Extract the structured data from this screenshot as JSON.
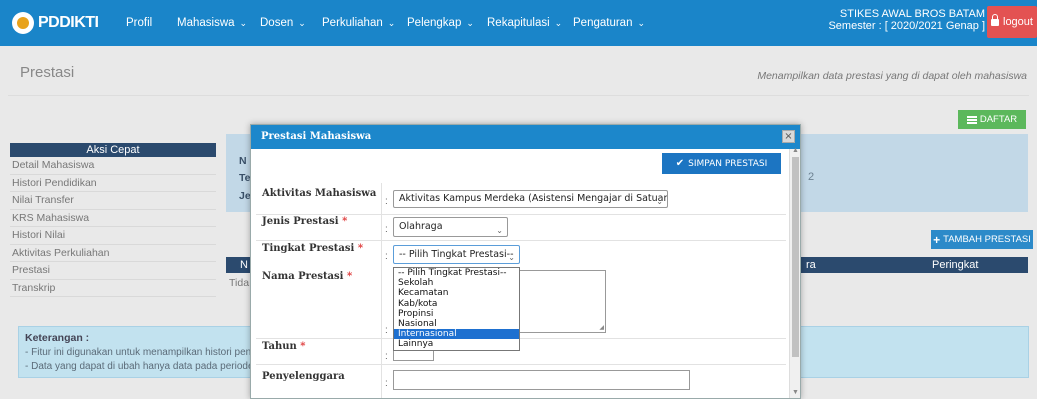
{
  "brand": {
    "name": "PDDIKTI"
  },
  "nav": [
    {
      "label": "Profil",
      "dropdown": false
    },
    {
      "label": "Mahasiswa",
      "dropdown": true
    },
    {
      "label": "Dosen",
      "dropdown": true
    },
    {
      "label": "Perkuliahan",
      "dropdown": true
    },
    {
      "label": "Pelengkap",
      "dropdown": true
    },
    {
      "label": "Rekapitulasi",
      "dropdown": true
    },
    {
      "label": "Pengaturan",
      "dropdown": true
    }
  ],
  "campus": {
    "name": "STIKES AWAL BROS BATAM",
    "semester": "Semester : [ 2020/2021 Genap ]"
  },
  "logout_label": "logout",
  "page": {
    "title": "Prestasi",
    "description": "Menampilkan data prestasi yang di dapat oleh mahasiswa",
    "daftar_label": "DAFTAR",
    "tambah_label": "TAMBAH PRESTASI"
  },
  "sidebar": {
    "title": "Aksi Cepat",
    "items": [
      "Detail Mahasiswa",
      "Histori Pendidikan",
      "Nilai Transfer",
      "KRS Mahasiswa",
      "Histori Nilai",
      "Aktivitas Perkuliahan",
      "Prestasi",
      "Transkrip"
    ]
  },
  "info": {
    "frag1": "N",
    "frag2": "Te",
    "frag3": "Je",
    "value": "2"
  },
  "table": {
    "col1": "N",
    "col2": "ra",
    "col3": "Peringkat",
    "empty": "Tida"
  },
  "keterangan": {
    "title": "Keterangan :",
    "line1": "- Fitur ini digunakan untuk menampilkan histori pendi",
    "line2": "- Data yang dapat di ubah hanya data pada periode a"
  },
  "modal": {
    "title": "Prestasi Mahasiswa",
    "close": "×",
    "save_label": "SIMPAN PRESTASI",
    "fields": {
      "aktivitas": {
        "label": "Aktivitas Mahasiswa",
        "value": "Aktivitas Kampus Merdeka (Asistensi Mengajar di Satuan Pe"
      },
      "jenis": {
        "label": "Jenis Prestasi",
        "value": "Olahraga"
      },
      "tingkat": {
        "label": "Tingkat Prestasi",
        "value": "-- Pilih Tingkat Prestasi--"
      },
      "nama": {
        "label": "Nama Prestasi"
      },
      "tahun": {
        "label": "Tahun"
      },
      "penyelenggara": {
        "label": "Penyelenggara"
      }
    },
    "required_mark": "*",
    "colon": ":",
    "tingkat_options": [
      "-- Pilih Tingkat Prestasi--",
      "Sekolah",
      "Kecamatan",
      "Kab/kota",
      "Propinsi",
      "Nasional",
      "Internasional",
      "Lainnya"
    ],
    "highlighted_option": "Internasional"
  }
}
